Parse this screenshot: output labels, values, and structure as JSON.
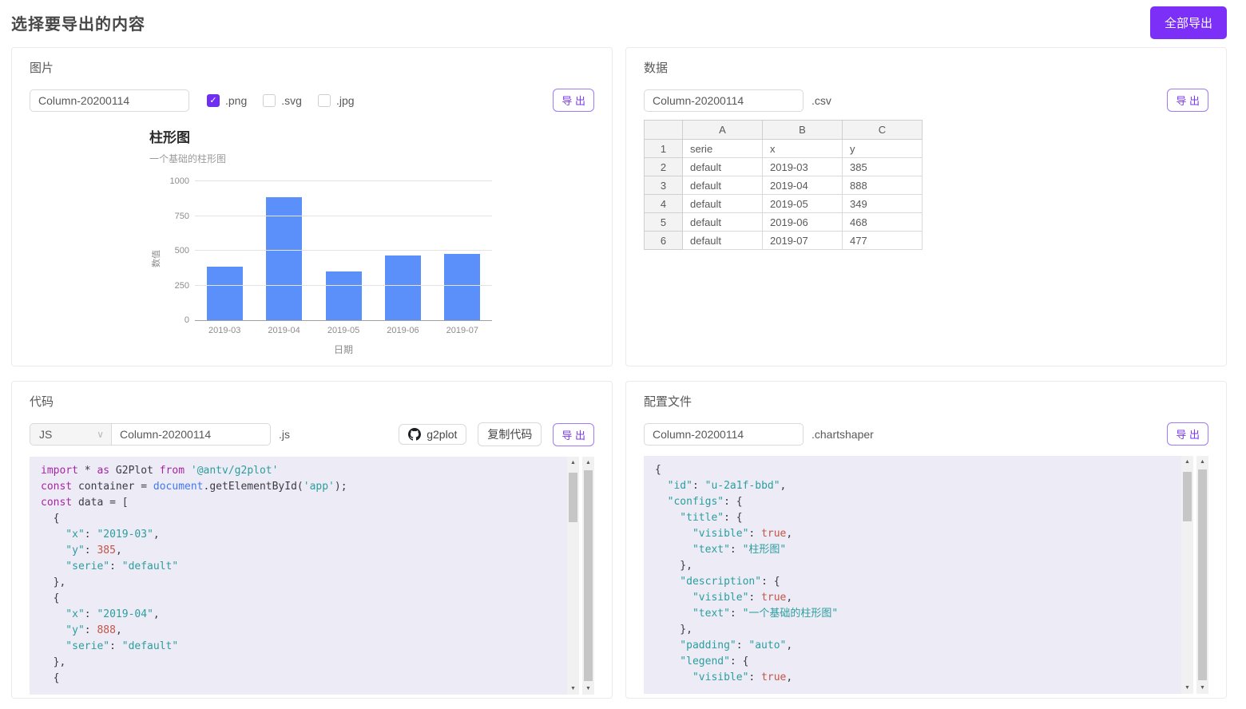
{
  "header": {
    "title": "选择要导出的内容",
    "export_all_label": "全部导出"
  },
  "colors": {
    "accent": "#7b2ff7",
    "export_outline": "#7c3aed",
    "bar": "#5b8ff9"
  },
  "panels": {
    "image": {
      "title": "图片",
      "filename": "Column-20200114",
      "formats": [
        {
          "label": ".png",
          "checked": true
        },
        {
          "label": ".svg",
          "checked": false
        },
        {
          "label": ".jpg",
          "checked": false
        }
      ],
      "export_label": "导 出"
    },
    "data": {
      "title": "数据",
      "filename": "Column-20200114",
      "extension": ".csv",
      "export_label": "导 出",
      "table": {
        "columns": [
          "",
          "A",
          "B",
          "C"
        ],
        "rows": [
          [
            "1",
            "serie",
            "x",
            "y"
          ],
          [
            "2",
            "default",
            "2019-03",
            "385"
          ],
          [
            "3",
            "default",
            "2019-04",
            "888"
          ],
          [
            "4",
            "default",
            "2019-05",
            "349"
          ],
          [
            "5",
            "default",
            "2019-06",
            "468"
          ],
          [
            "6",
            "default",
            "2019-07",
            "477"
          ]
        ]
      }
    },
    "code": {
      "title": "代码",
      "language": "JS",
      "filename": "Column-20200114",
      "extension": ".js",
      "github_label": "g2plot",
      "copy_label": "复制代码",
      "export_label": "导 出",
      "lines": [
        [
          [
            "kw",
            "import"
          ],
          [
            "pl",
            " * "
          ],
          [
            "kw",
            "as"
          ],
          [
            "pl",
            " G2Plot "
          ],
          [
            "kw",
            "from"
          ],
          [
            "pl",
            " "
          ],
          [
            "str",
            "'@antv/g2plot'"
          ]
        ],
        [
          [
            "kw",
            "const"
          ],
          [
            "pl",
            " container = "
          ],
          [
            "blue",
            "document"
          ],
          [
            "pl",
            ".getElementById("
          ],
          [
            "str",
            "'app'"
          ],
          [
            "pl",
            ");"
          ]
        ],
        [
          [
            "kw",
            "const"
          ],
          [
            "pl",
            " data = ["
          ]
        ],
        [
          [
            "pl",
            "  {"
          ]
        ],
        [
          [
            "str",
            "    \"x\""
          ],
          [
            "pl",
            ": "
          ],
          [
            "str",
            "\"2019-03\""
          ],
          [
            "pl",
            ","
          ]
        ],
        [
          [
            "str",
            "    \"y\""
          ],
          [
            "pl",
            ": "
          ],
          [
            "num",
            "385"
          ],
          [
            "pl",
            ","
          ]
        ],
        [
          [
            "str",
            "    \"serie\""
          ],
          [
            "pl",
            ": "
          ],
          [
            "str",
            "\"default\""
          ]
        ],
        [
          [
            "pl",
            "  },"
          ]
        ],
        [
          [
            "pl",
            "  {"
          ]
        ],
        [
          [
            "str",
            "    \"x\""
          ],
          [
            "pl",
            ": "
          ],
          [
            "str",
            "\"2019-04\""
          ],
          [
            "pl",
            ","
          ]
        ],
        [
          [
            "str",
            "    \"y\""
          ],
          [
            "pl",
            ": "
          ],
          [
            "num",
            "888"
          ],
          [
            "pl",
            ","
          ]
        ],
        [
          [
            "str",
            "    \"serie\""
          ],
          [
            "pl",
            ": "
          ],
          [
            "str",
            "\"default\""
          ]
        ],
        [
          [
            "pl",
            "  },"
          ]
        ],
        [
          [
            "pl",
            "  {"
          ]
        ]
      ]
    },
    "config": {
      "title": "配置文件",
      "filename": "Column-20200114",
      "extension": ".chartshaper",
      "export_label": "导 出",
      "lines": [
        [
          [
            "pl",
            "{"
          ]
        ],
        [
          [
            "str",
            "  \"id\""
          ],
          [
            "pl",
            ": "
          ],
          [
            "str",
            "\"u-2a1f-bbd\""
          ],
          [
            "pl",
            ","
          ]
        ],
        [
          [
            "str",
            "  \"configs\""
          ],
          [
            "pl",
            ": {"
          ]
        ],
        [
          [
            "str",
            "    \"title\""
          ],
          [
            "pl",
            ": {"
          ]
        ],
        [
          [
            "str",
            "      \"visible\""
          ],
          [
            "pl",
            ": "
          ],
          [
            "num",
            "true"
          ],
          [
            "pl",
            ","
          ]
        ],
        [
          [
            "str",
            "      \"text\""
          ],
          [
            "pl",
            ": "
          ],
          [
            "str",
            "\"柱形图\""
          ]
        ],
        [
          [
            "pl",
            "    },"
          ]
        ],
        [
          [
            "str",
            "    \"description\""
          ],
          [
            "pl",
            ": {"
          ]
        ],
        [
          [
            "str",
            "      \"visible\""
          ],
          [
            "pl",
            ": "
          ],
          [
            "num",
            "true"
          ],
          [
            "pl",
            ","
          ]
        ],
        [
          [
            "str",
            "      \"text\""
          ],
          [
            "pl",
            ": "
          ],
          [
            "str",
            "\"一个基础的柱形图\""
          ]
        ],
        [
          [
            "pl",
            "    },"
          ]
        ],
        [
          [
            "str",
            "    \"padding\""
          ],
          [
            "pl",
            ": "
          ],
          [
            "str",
            "\"auto\""
          ],
          [
            "pl",
            ","
          ]
        ],
        [
          [
            "str",
            "    \"legend\""
          ],
          [
            "pl",
            ": {"
          ]
        ],
        [
          [
            "str",
            "      \"visible\""
          ],
          [
            "pl",
            ": "
          ],
          [
            "num",
            "true"
          ],
          [
            "pl",
            ","
          ]
        ]
      ]
    }
  },
  "chart_data": {
    "type": "bar",
    "title": "柱形图",
    "subtitle": "一个基础的柱形图",
    "categories": [
      "2019-03",
      "2019-04",
      "2019-05",
      "2019-06",
      "2019-07"
    ],
    "values": [
      385,
      888,
      349,
      468,
      477
    ],
    "series_name": "default",
    "xlabel": "日期",
    "ylabel": "数值",
    "ylim": [
      0,
      1000
    ],
    "yticks": [
      0,
      250,
      500,
      750,
      1000
    ],
    "grid": true,
    "legend": false
  }
}
